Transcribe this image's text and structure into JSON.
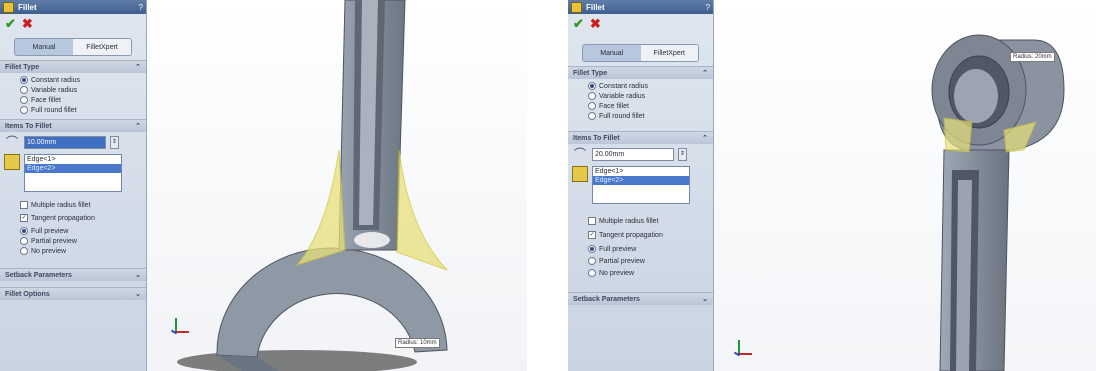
{
  "left": {
    "panel": {
      "title": "Fillet",
      "help": "?",
      "tabs": [
        "Manual",
        "FilletXpert"
      ],
      "fillet_type": {
        "header": "Fillet Type",
        "options": [
          "Constant radius",
          "Variable radius",
          "Face fillet",
          "Full round fillet"
        ],
        "selected": 0
      },
      "items": {
        "header": "Items To Fillet",
        "radius": "10.00mm",
        "edges": [
          "Edge<1>",
          "Edge<2>"
        ]
      },
      "checks": [
        {
          "label": "Multiple radius fillet",
          "checked": false
        },
        {
          "label": "Tangent propagation",
          "checked": true
        }
      ],
      "preview": {
        "options": [
          "Full preview",
          "Partial preview",
          "No preview"
        ],
        "selected": 0
      },
      "setback_header": "Setback Parameters",
      "fillet_options_header": "Fillet Options"
    },
    "viewport": {
      "callout": "Radius: 10mm"
    }
  },
  "right": {
    "panel": {
      "title": "Fillet",
      "help": "?",
      "tabs": [
        "Manual",
        "FilletXpert"
      ],
      "fillet_type": {
        "header": "Fillet Type",
        "options": [
          "Constant radius",
          "Variable radius",
          "Face fillet",
          "Full round fillet"
        ],
        "selected": 0
      },
      "items": {
        "header": "Items To Fillet",
        "radius": "20.00mm",
        "edges": [
          "Edge<1>",
          "Edge<2>"
        ]
      },
      "checks": [
        {
          "label": "Multiple radius fillet",
          "checked": false
        },
        {
          "label": "Tangent propagation",
          "checked": true
        }
      ],
      "preview": {
        "options": [
          "Full preview",
          "Partial preview",
          "No preview"
        ],
        "selected": 0
      },
      "setback_header": "Setback Parameters"
    },
    "viewport": {
      "callout": "Radius: 20mm"
    }
  },
  "colors": {
    "model": "#8d97a4",
    "model_dark": "#5f6874",
    "highlight": "#e7e07a",
    "panel": "#d3dce8"
  }
}
